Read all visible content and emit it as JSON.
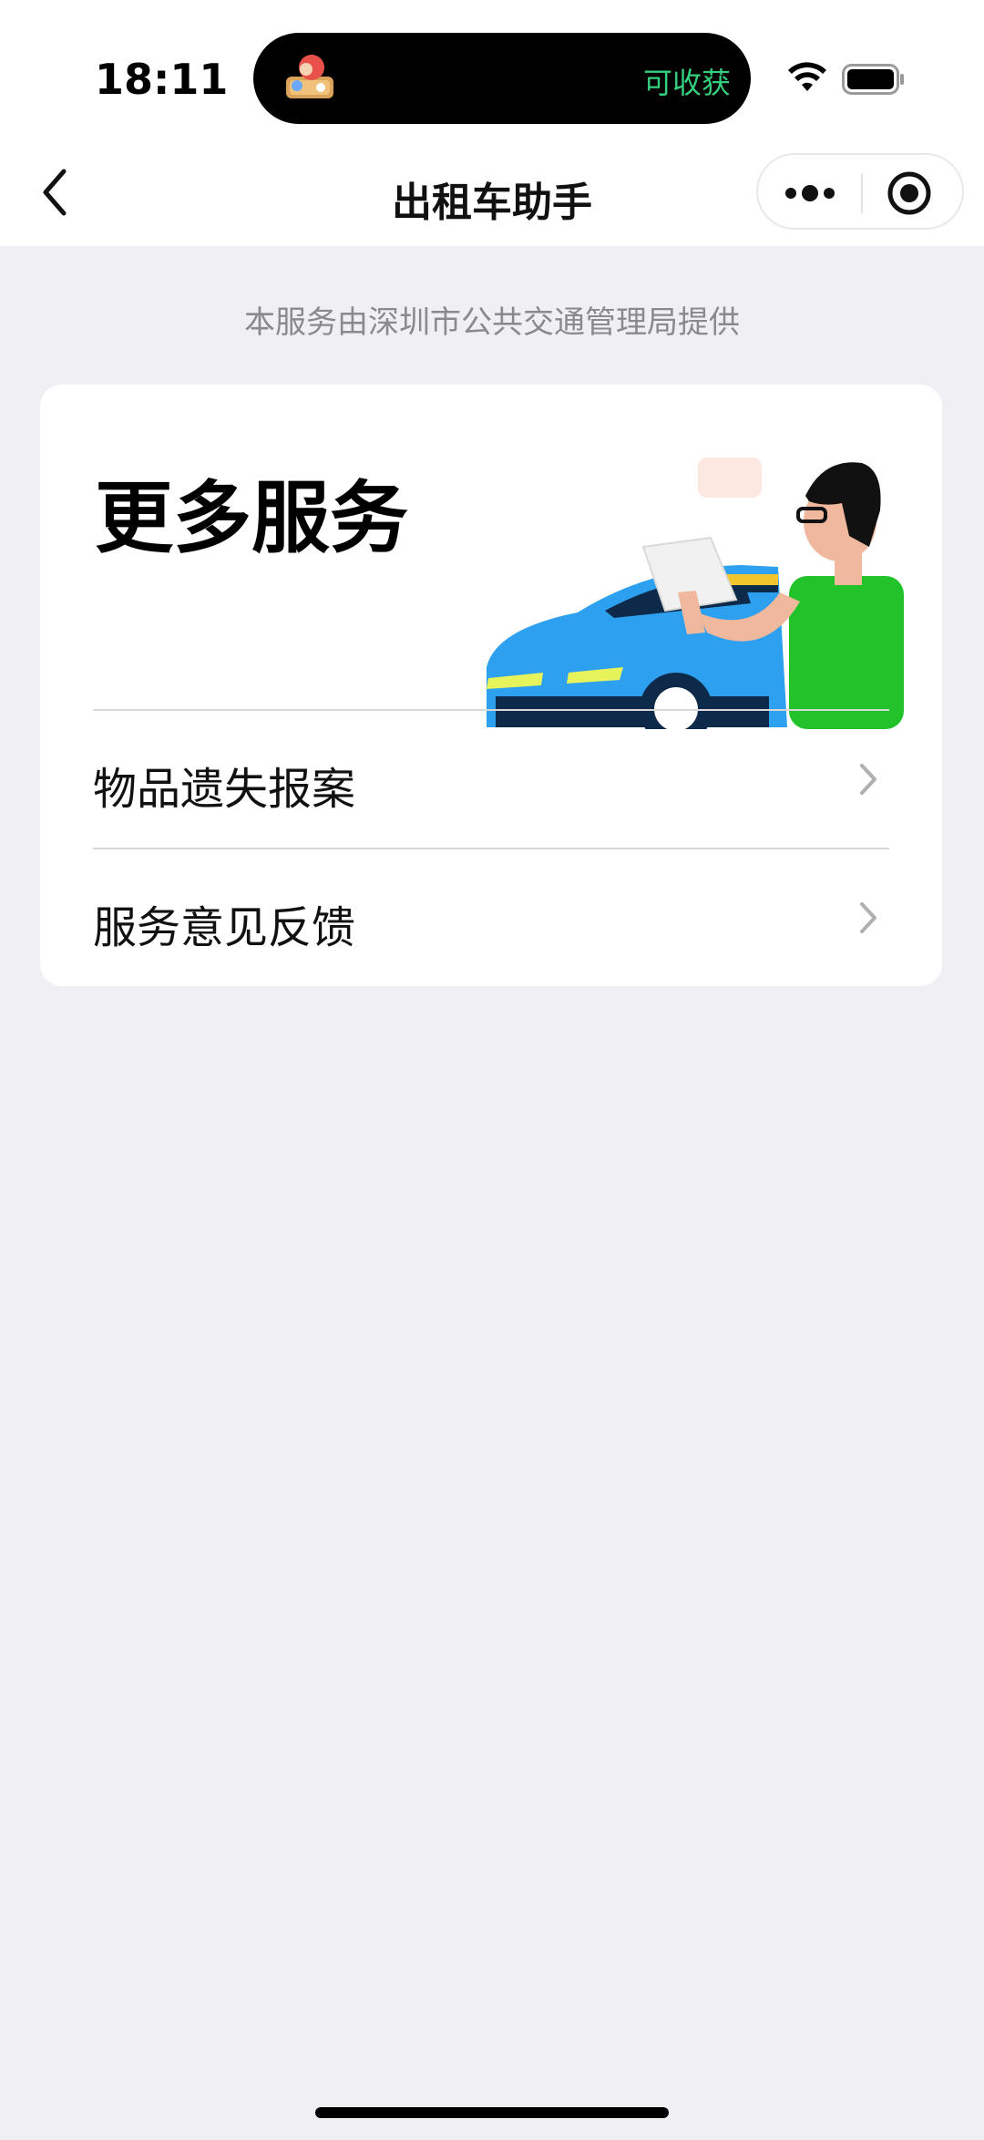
{
  "status_bar": {
    "time": "18:11",
    "island_text": "可收获",
    "island_text_color": "#35d07f"
  },
  "nav": {
    "title": "出租车助手",
    "back_icon": "chevron-left-icon",
    "more_icon": "more-dots-icon",
    "close_icon": "target-circle-icon"
  },
  "provider_note": "本服务由深圳市公共交通管理局提供",
  "card": {
    "title": "更多服务",
    "items": [
      {
        "label": "物品遗失报案",
        "icon": "chevron-right-icon"
      },
      {
        "label": "服务意见反馈",
        "icon": "chevron-right-icon"
      }
    ]
  },
  "colors": {
    "background": "#efeff4",
    "car_blue": "#2ea0f0",
    "shirt_green": "#22c22a"
  }
}
